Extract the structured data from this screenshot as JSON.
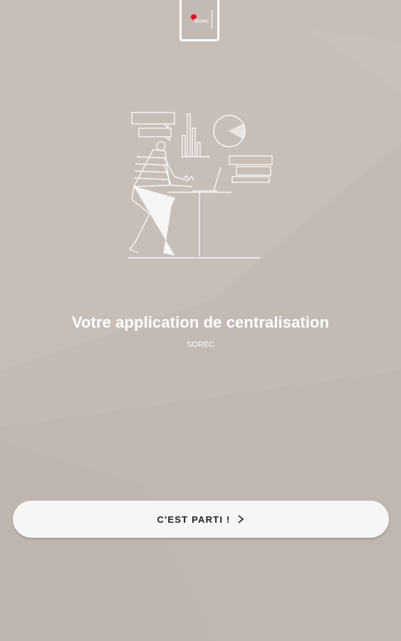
{
  "brand": {
    "logo_text": "Sorec",
    "logo_dot_color": "#e0102a"
  },
  "welcome": {
    "title": "Votre application de centralisation",
    "subtitle": "SOREC"
  },
  "cta": {
    "label": "C'EST PARTI !",
    "icon": "chevron-right-icon"
  },
  "colors": {
    "background": "#c4bab4",
    "button_bg": "#f7f6f5",
    "text_light": "#ffffff"
  }
}
